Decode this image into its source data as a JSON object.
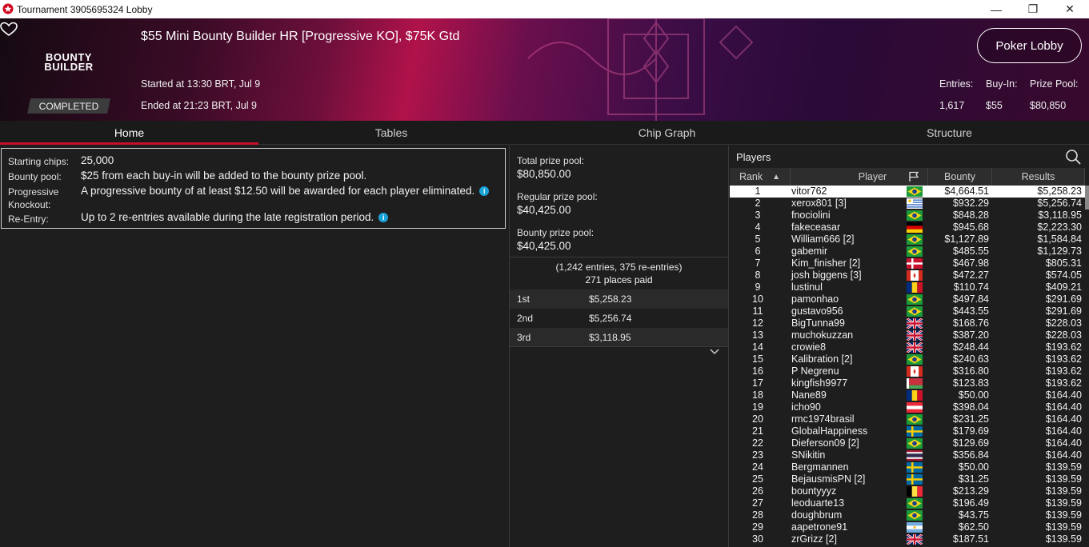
{
  "window": {
    "title": "Tournament 3905695324 Lobby",
    "minimize": "—",
    "maximize": "❐",
    "close": "✕"
  },
  "header": {
    "logo_line1": "BOUNTY",
    "logo_line2": "BUILDER",
    "status": "COMPLETED",
    "title": "$55 Mini Bounty Builder HR [Progressive KO], $75K Gtd",
    "started": "Started at 13:30 BRT, Jul 9",
    "ended": "Ended at 21:23 BRT, Jul 9",
    "lobby_button": "Poker Lobby",
    "entries_label": "Entries:",
    "entries_value": "1,617",
    "buyin_label": "Buy-In:",
    "buyin_value": "$55",
    "prizepool_label": "Prize Pool:",
    "prizepool_value": "$80,850"
  },
  "tabs": [
    "Home",
    "Tables",
    "Chip Graph",
    "Structure"
  ],
  "info": {
    "starting_chips_label": "Starting chips:",
    "starting_chips_value": "25,000",
    "bounty_pool_label": "Bounty pool:",
    "bounty_pool_value": "$25 from each buy-in will be added to the bounty prize pool.",
    "progressive_label": "Progressive Knockout:",
    "progressive_value": "A progressive bounty of at least $12.50 will be awarded for each player eliminated.",
    "reentry_label": "Re-Entry:",
    "reentry_value": "Up to 2 re-entries available during the late registration period.",
    "info_icon": "i"
  },
  "prizes": {
    "total_label": "Total prize pool:",
    "total_value": "$80,850.00",
    "regular_label": "Regular prize pool:",
    "regular_value": "$40,425.00",
    "bounty_label": "Bounty prize pool:",
    "bounty_value": "$40,425.00",
    "entries_note": "(1,242 entries, 375 re-entries)",
    "places_paid": "271 places paid",
    "payouts": [
      {
        "place": "1st",
        "amount": "$5,258.23"
      },
      {
        "place": "2nd",
        "amount": "$5,256.74"
      },
      {
        "place": "3rd",
        "amount": "$3,118.95"
      }
    ]
  },
  "players": {
    "title": "Players",
    "columns": {
      "rank": "Rank",
      "player": "Player",
      "bounty": "Bounty",
      "results": "Results"
    },
    "rows": [
      {
        "rank": "1",
        "name": "vitor762",
        "flag": "br",
        "bounty": "$4,664.51",
        "result": "$5,258.23"
      },
      {
        "rank": "2",
        "name": "xerox801 [3]",
        "flag": "uy",
        "bounty": "$932.29",
        "result": "$5,256.74"
      },
      {
        "rank": "3",
        "name": "fnociolini",
        "flag": "br",
        "bounty": "$848.28",
        "result": "$3,118.95"
      },
      {
        "rank": "4",
        "name": "fakeceasar",
        "flag": "de",
        "bounty": "$945.68",
        "result": "$2,223.30"
      },
      {
        "rank": "5",
        "name": "William666 [2]",
        "flag": "br",
        "bounty": "$1,127.89",
        "result": "$1,584.84"
      },
      {
        "rank": "6",
        "name": "gabemir",
        "flag": "br",
        "bounty": "$485.55",
        "result": "$1,129.73"
      },
      {
        "rank": "7",
        "name": "Kim_finisher [2]",
        "flag": "dk",
        "bounty": "$467.98",
        "result": "$805.31"
      },
      {
        "rank": "8",
        "name": "josh biggens [3]",
        "flag": "ca",
        "bounty": "$472.27",
        "result": "$574.05"
      },
      {
        "rank": "9",
        "name": "lustinul",
        "flag": "ro",
        "bounty": "$110.74",
        "result": "$409.21"
      },
      {
        "rank": "10",
        "name": "pamonhao",
        "flag": "br",
        "bounty": "$497.84",
        "result": "$291.69"
      },
      {
        "rank": "11",
        "name": "gustavo956",
        "flag": "br",
        "bounty": "$443.55",
        "result": "$291.69"
      },
      {
        "rank": "12",
        "name": "BigTunna99",
        "flag": "gb",
        "bounty": "$168.76",
        "result": "$228.03"
      },
      {
        "rank": "13",
        "name": "muchokuzzan",
        "flag": "gb",
        "bounty": "$387.20",
        "result": "$228.03"
      },
      {
        "rank": "14",
        "name": "crowie8",
        "flag": "gb",
        "bounty": "$248.44",
        "result": "$193.62"
      },
      {
        "rank": "15",
        "name": "Kalibration [2]",
        "flag": "br",
        "bounty": "$240.63",
        "result": "$193.62"
      },
      {
        "rank": "16",
        "name": "P Negrenu",
        "flag": "ca",
        "bounty": "$316.80",
        "result": "$193.62"
      },
      {
        "rank": "17",
        "name": "kingfish9977",
        "flag": "by",
        "bounty": "$123.83",
        "result": "$193.62"
      },
      {
        "rank": "18",
        "name": "Nane89",
        "flag": "ro",
        "bounty": "$50.00",
        "result": "$164.40"
      },
      {
        "rank": "19",
        "name": "icho90",
        "flag": "at",
        "bounty": "$398.04",
        "result": "$164.40"
      },
      {
        "rank": "20",
        "name": "rmc1974brasil",
        "flag": "br",
        "bounty": "$231.25",
        "result": "$164.40"
      },
      {
        "rank": "21",
        "name": "GlobalHappiness",
        "flag": "se",
        "bounty": "$179.69",
        "result": "$164.40"
      },
      {
        "rank": "22",
        "name": "Dieferson09 [2]",
        "flag": "br",
        "bounty": "$129.69",
        "result": "$164.40"
      },
      {
        "rank": "23",
        "name": "SNikitin",
        "flag": "th",
        "bounty": "$356.84",
        "result": "$164.40"
      },
      {
        "rank": "24",
        "name": "Bergmannen",
        "flag": "se",
        "bounty": "$50.00",
        "result": "$139.59"
      },
      {
        "rank": "25",
        "name": "BejausmisPN [2]",
        "flag": "se",
        "bounty": "$31.25",
        "result": "$139.59"
      },
      {
        "rank": "26",
        "name": "bountyyyz",
        "flag": "be",
        "bounty": "$213.29",
        "result": "$139.59"
      },
      {
        "rank": "27",
        "name": "leoduarte13",
        "flag": "br",
        "bounty": "$196.49",
        "result": "$139.59"
      },
      {
        "rank": "28",
        "name": "doughbrum",
        "flag": "br",
        "bounty": "$43.75",
        "result": "$139.59"
      },
      {
        "rank": "29",
        "name": "aapetrone91",
        "flag": "ar",
        "bounty": "$62.50",
        "result": "$139.59"
      },
      {
        "rank": "30",
        "name": "zrGrizz [2]",
        "flag": "gb",
        "bounty": "$187.51",
        "result": "$139.59"
      }
    ]
  }
}
